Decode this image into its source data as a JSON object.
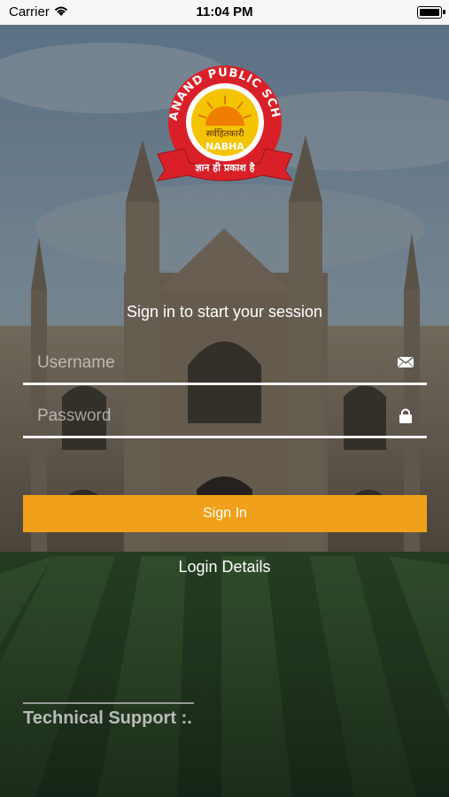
{
  "status_bar": {
    "carrier": "Carrier",
    "time": "11:04 PM"
  },
  "logo": {
    "arc_text": "DAYANAND PUBLIC SCHOOL",
    "center_text": "सर्वहितकारी",
    "place": "NABHA",
    "ribbon_text": "ज्ञान ही प्रकाश है"
  },
  "login": {
    "tagline": "Sign in to start your session",
    "username_placeholder": "Username",
    "password_placeholder": "Password",
    "signin_label": "Sign In",
    "login_details": "Login Details",
    "technical_support": "Technical Support :."
  },
  "colors": {
    "accent": "#f0a01a",
    "logo_red": "#d92028",
    "logo_yellow": "#f5c400"
  },
  "icons": {
    "username": "envelope-icon",
    "password": "lock-icon"
  }
}
